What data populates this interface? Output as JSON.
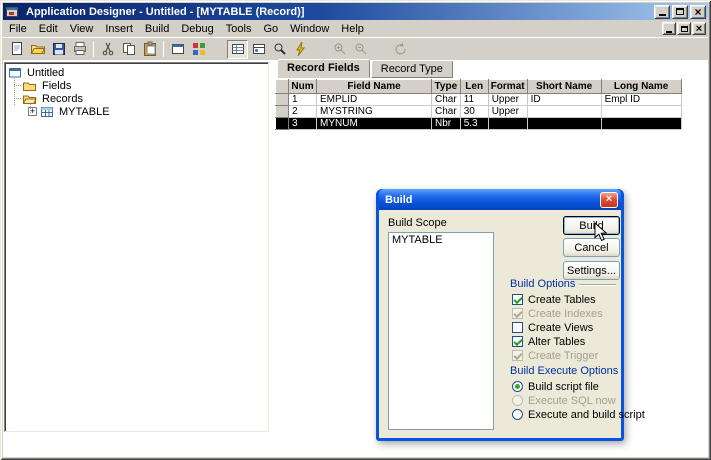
{
  "titlebar": {
    "title": "Application Designer - Untitled - [MYTABLE (Record)]"
  },
  "menu": {
    "items": [
      "File",
      "Edit",
      "View",
      "Insert",
      "Build",
      "Debug",
      "Tools",
      "Go",
      "Window",
      "Help"
    ]
  },
  "toolbar": {
    "buttons": [
      "new",
      "open",
      "save",
      "print",
      "cut",
      "copy",
      "paste",
      "object-properties",
      "build-project",
      "record-fields-view",
      "record-type-view",
      "find-object-references",
      "validate",
      "zoom-in",
      "zoom-out",
      "refresh"
    ]
  },
  "tree": {
    "root": "Untitled",
    "fields": "Fields",
    "records": "Records",
    "mytable": "MYTABLE"
  },
  "tabs": [
    {
      "label": "Record Fields",
      "active": true
    },
    {
      "label": "Record Type",
      "active": false
    }
  ],
  "grid": {
    "headers": [
      "Num",
      "Field Name",
      "Type",
      "Len",
      "Format",
      "Short Name",
      "Long Name"
    ],
    "rows": [
      {
        "cells": [
          "1",
          "EMPLID",
          "Char",
          "11",
          "Upper",
          "ID",
          "Empl ID"
        ],
        "selected": false
      },
      {
        "cells": [
          "2",
          "MYSTRING",
          "Char",
          "30",
          "Upper",
          "",
          ""
        ],
        "selected": false
      },
      {
        "cells": [
          "3",
          "MYNUM",
          "Nbr",
          "5.3",
          "",
          "",
          ""
        ],
        "selected": true
      }
    ]
  },
  "dialog": {
    "title": "Build",
    "scope_label": "Build Scope",
    "scope_items": [
      "MYTABLE"
    ],
    "buttons": {
      "build": "Build",
      "cancel": "Cancel",
      "settings": "Settings..."
    },
    "build_options": {
      "label": "Build Options",
      "items": [
        {
          "label": "Create Tables",
          "checked": true,
          "enabled": true
        },
        {
          "label": "Create Indexes",
          "checked": true,
          "enabled": false
        },
        {
          "label": "Create Views",
          "checked": false,
          "enabled": true
        },
        {
          "label": "Alter Tables",
          "checked": true,
          "enabled": true
        },
        {
          "label": "Create Trigger",
          "checked": true,
          "enabled": false
        }
      ]
    },
    "execute_options": {
      "label": "Build Execute Options",
      "items": [
        {
          "label": "Build script file",
          "selected": true,
          "enabled": true
        },
        {
          "label": "Execute SQL now",
          "selected": false,
          "enabled": false
        },
        {
          "label": "Execute and build script",
          "selected": false,
          "enabled": true
        }
      ]
    }
  },
  "icons": {
    "close": "×",
    "plus": "+"
  },
  "colors": {
    "titlebar_gradient_start": "#0a246a",
    "titlebar_gradient_end": "#a6caf0",
    "luna_blue": "#0855dd",
    "selection": "#000000",
    "chrome": "#d4d0c8",
    "dialog_face": "#ece9d8"
  }
}
